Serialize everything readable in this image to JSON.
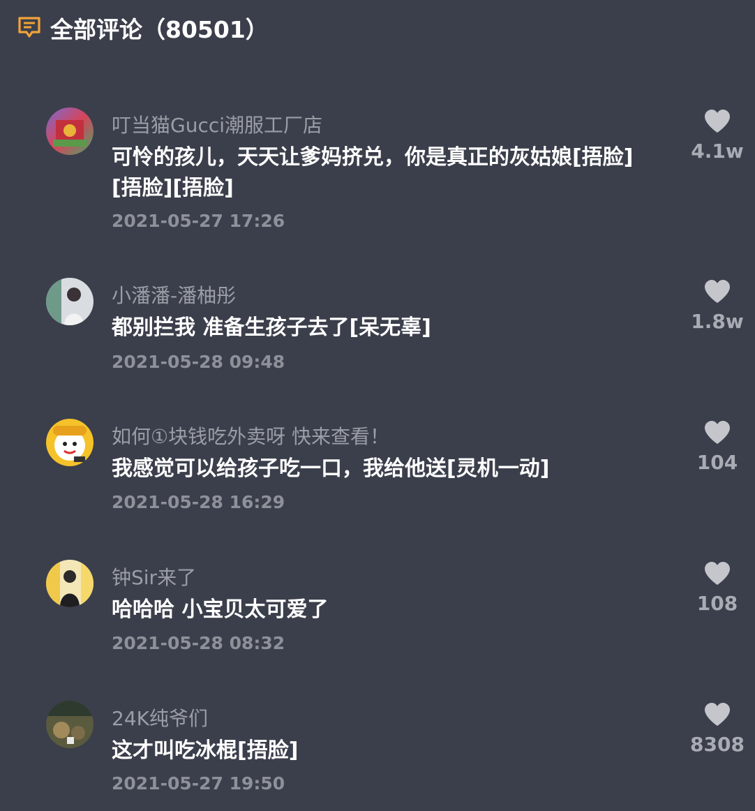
{
  "header": {
    "title": "全部评论（80501）",
    "icon": "comment-icon"
  },
  "colors": {
    "background": "#3b3f4b",
    "accent": "#f2a33a",
    "username": "#9b9ea7",
    "timestamp": "#8e919a",
    "like_count": "#a9acb4"
  },
  "comments": [
    {
      "username": "叮当猫Gucci潮服工厂店",
      "text": "可怜的孩儿，天天让爹妈挤兑，你是真正的灰姑娘[捂脸][捂脸][捂脸]",
      "time": "2021-05-27 17:26",
      "likes": "4.1w"
    },
    {
      "username": "小潘潘-潘柚彤",
      "text": "都别拦我 准备生孩子去了[呆无辜]",
      "time": "2021-05-28 09:48",
      "likes": "1.8w"
    },
    {
      "username": "如何①块钱吃外卖呀 快来查看！",
      "text": "我感觉可以给孩子吃一口，我给他送[灵机一动]",
      "time": "2021-05-28 16:29",
      "likes": "104"
    },
    {
      "username": "钟Sir来了",
      "text": "哈哈哈 小宝贝太可爱了",
      "time": "2021-05-28 08:32",
      "likes": "108"
    },
    {
      "username": "24K纯爷们",
      "text": "这才叫吃冰棍[捂脸]",
      "time": "2021-05-27 19:50",
      "likes": "8308"
    }
  ]
}
